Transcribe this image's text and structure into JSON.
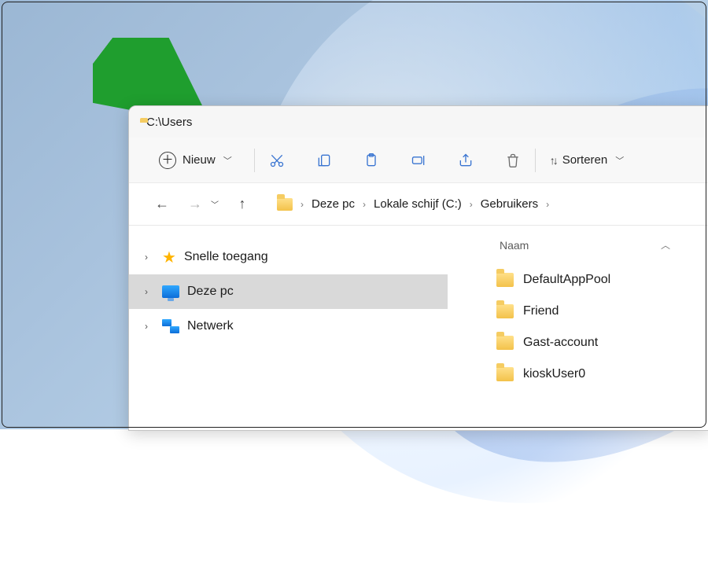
{
  "window": {
    "title": "C:\\Users"
  },
  "toolbar": {
    "new_label": "Nieuw",
    "sort_label": "Sorteren"
  },
  "breadcrumb": {
    "items": [
      "Deze pc",
      "Lokale schijf (C:)",
      "Gebruikers"
    ]
  },
  "navpane": {
    "items": [
      {
        "label": "Snelle toegang",
        "icon": "star"
      },
      {
        "label": "Deze pc",
        "icon": "monitor",
        "selected": true
      },
      {
        "label": "Netwerk",
        "icon": "network"
      }
    ]
  },
  "list": {
    "column": "Naam",
    "rows": [
      "DefaultAppPool",
      "Friend",
      "Gast-account",
      "kioskUser0"
    ]
  }
}
